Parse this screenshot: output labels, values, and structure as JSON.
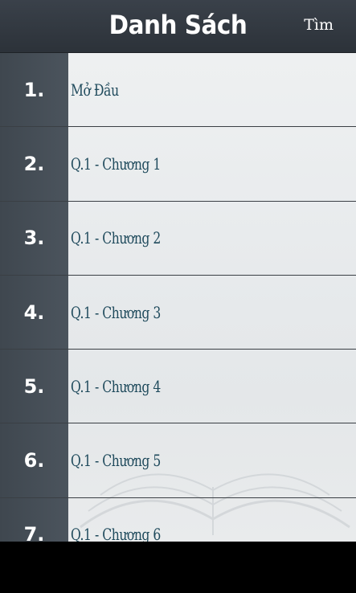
{
  "header": {
    "title": "Danh Sách",
    "search_label": "Tìm"
  },
  "chapters": [
    {
      "number": "1.",
      "title": "Mở Đầu"
    },
    {
      "number": "2.",
      "title": "Q.1 - Chương 1"
    },
    {
      "number": "3.",
      "title": "Q.1 - Chương 2"
    },
    {
      "number": "4.",
      "title": "Q.1 - Chương 3"
    },
    {
      "number": "5.",
      "title": "Q.1 - Chương 4"
    },
    {
      "number": "6.",
      "title": "Q.1 - Chương 5"
    },
    {
      "number": "7.",
      "title": "Q.1 - Chương 6"
    }
  ],
  "colors": {
    "header_bg": "#2f353c",
    "number_column_bg": "#454d55",
    "title_text": "#1f4a5c",
    "list_bg": "#eceeef"
  }
}
